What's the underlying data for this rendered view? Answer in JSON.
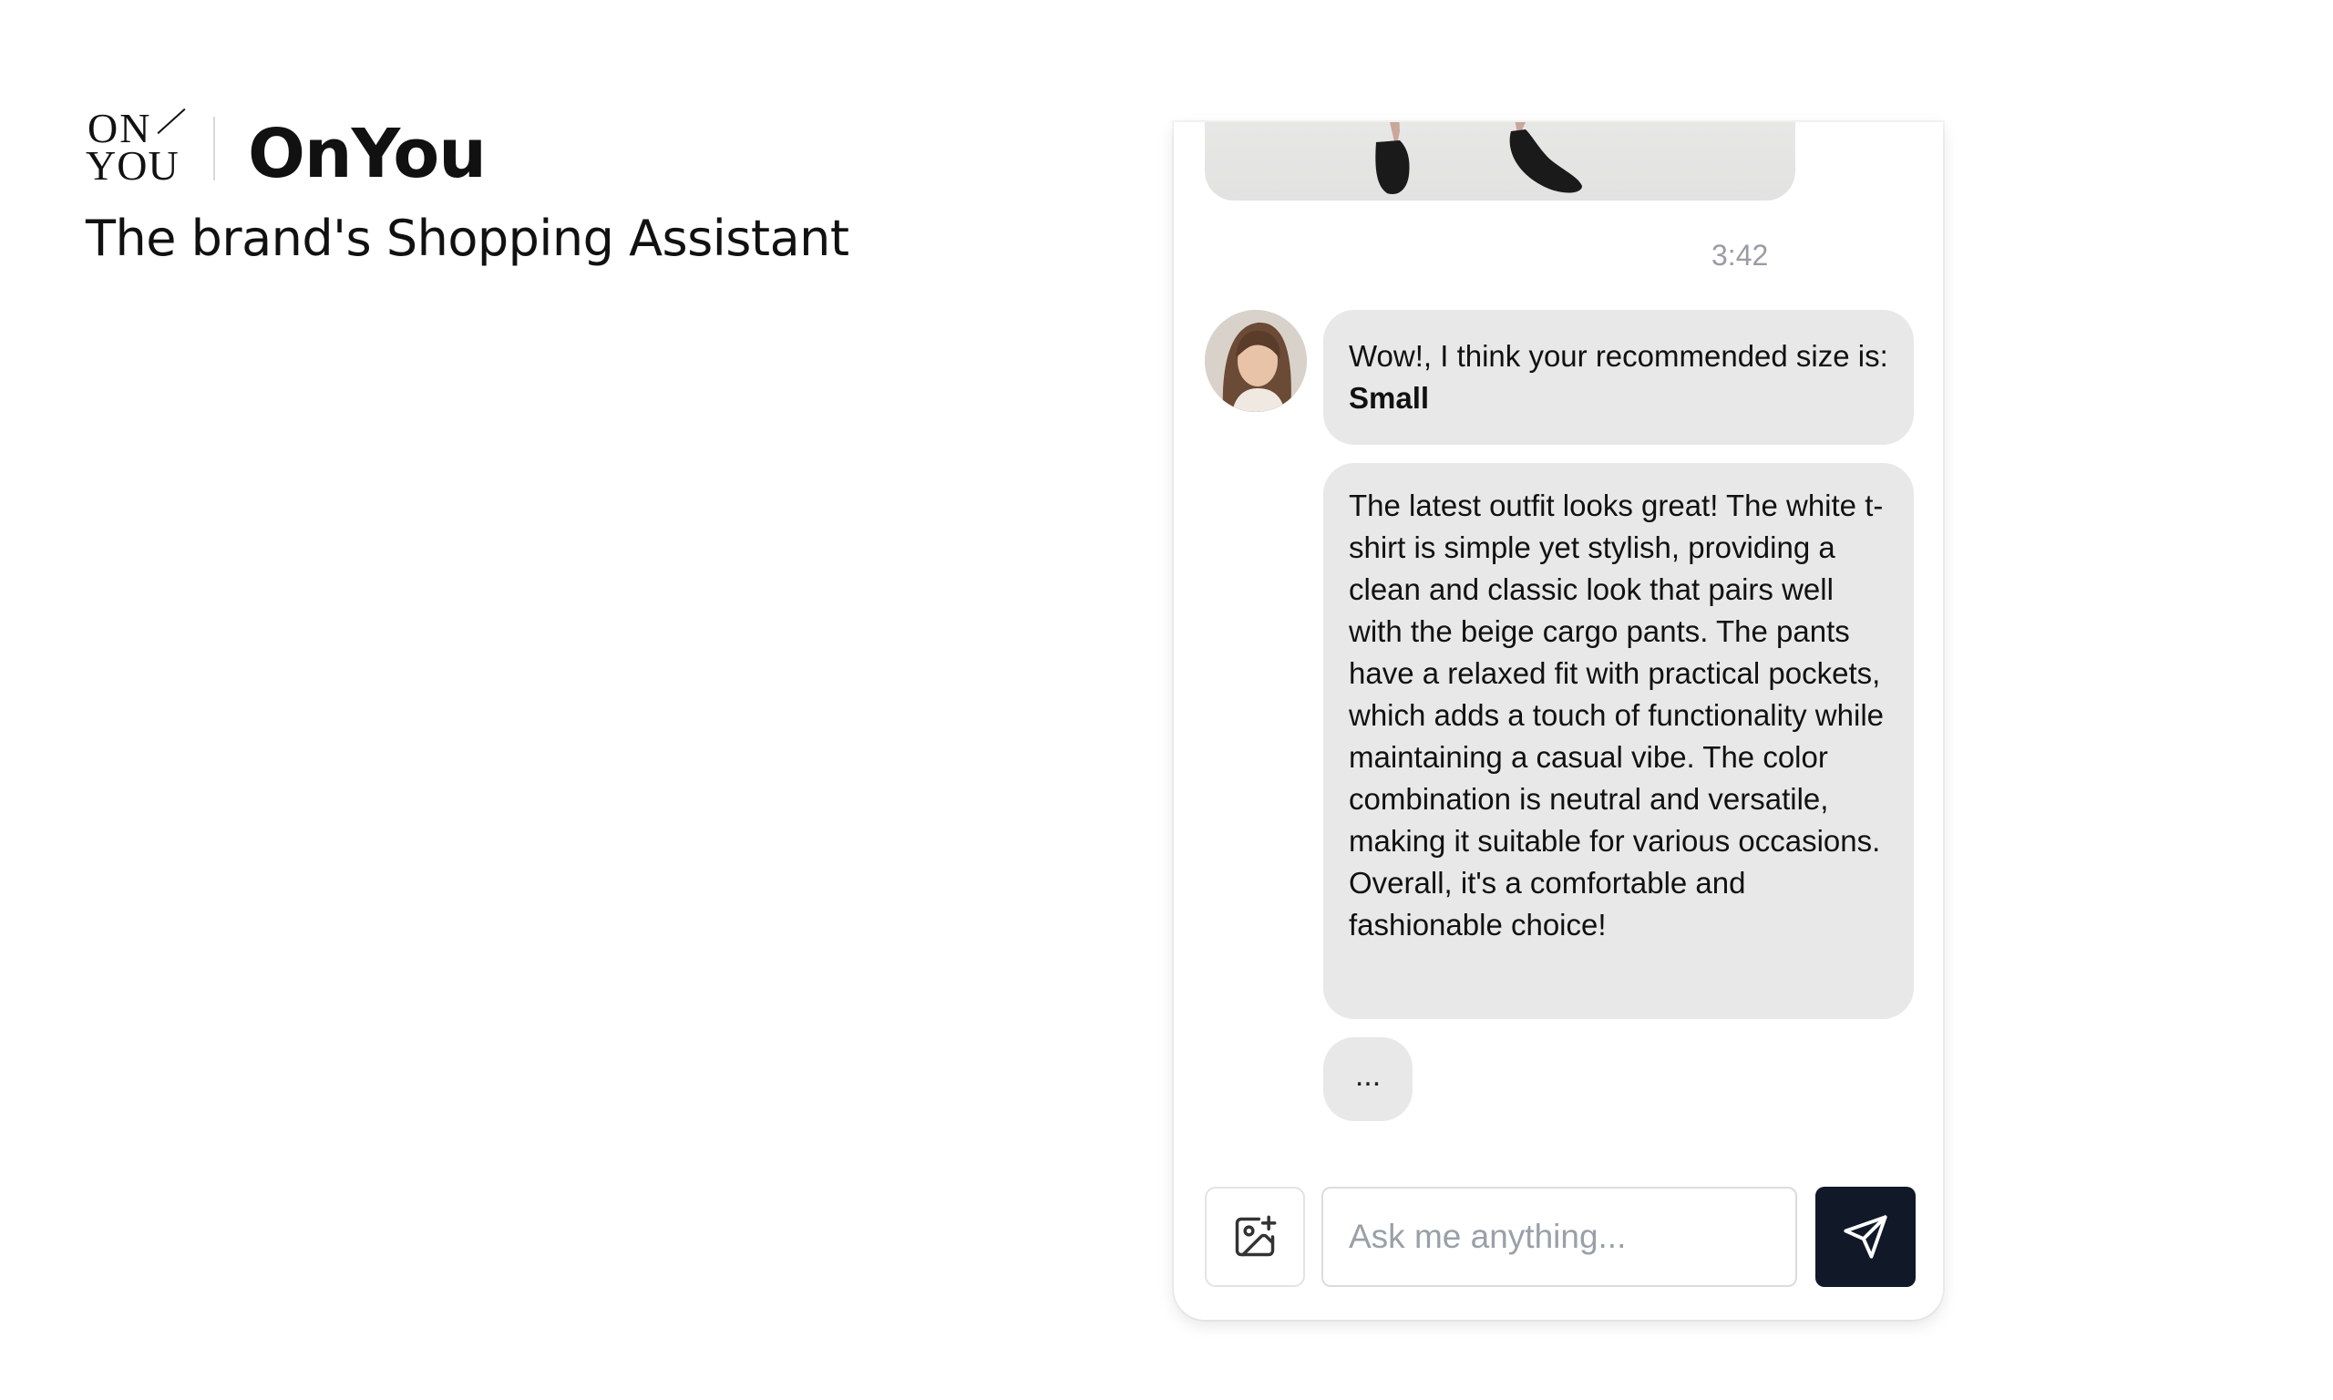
{
  "brand": {
    "logo_top": "ON",
    "logo_bottom": "YOU",
    "name": "OnYou",
    "tagline": "The brand's Shopping Assistant"
  },
  "chat": {
    "timestamp": "3:42",
    "messages": [
      {
        "sender": "assistant",
        "text_prefix": "Wow!, I think your recommended size is: ",
        "text_bold": "Small"
      },
      {
        "sender": "assistant",
        "text": "The latest outfit looks great! The white t-shirt is simple yet stylish, providing a clean and classic look that pairs well with the beige cargo pants. The pants have a relaxed fit with practical pockets, which adds a touch of functionality while maintaining a casual vibe. The color combination is neutral and versatile, making it suitable for various occasions. Overall, it's a comfortable and fashionable choice!"
      }
    ],
    "typing_indicator": "...",
    "input": {
      "placeholder": "Ask me anything...",
      "value": ""
    },
    "icons": {
      "upload": "image-plus-icon",
      "send": "send-icon"
    },
    "colors": {
      "bubble": "#e8e8e8",
      "send_button": "#111827",
      "timestamp": "#9a9ca3"
    }
  }
}
